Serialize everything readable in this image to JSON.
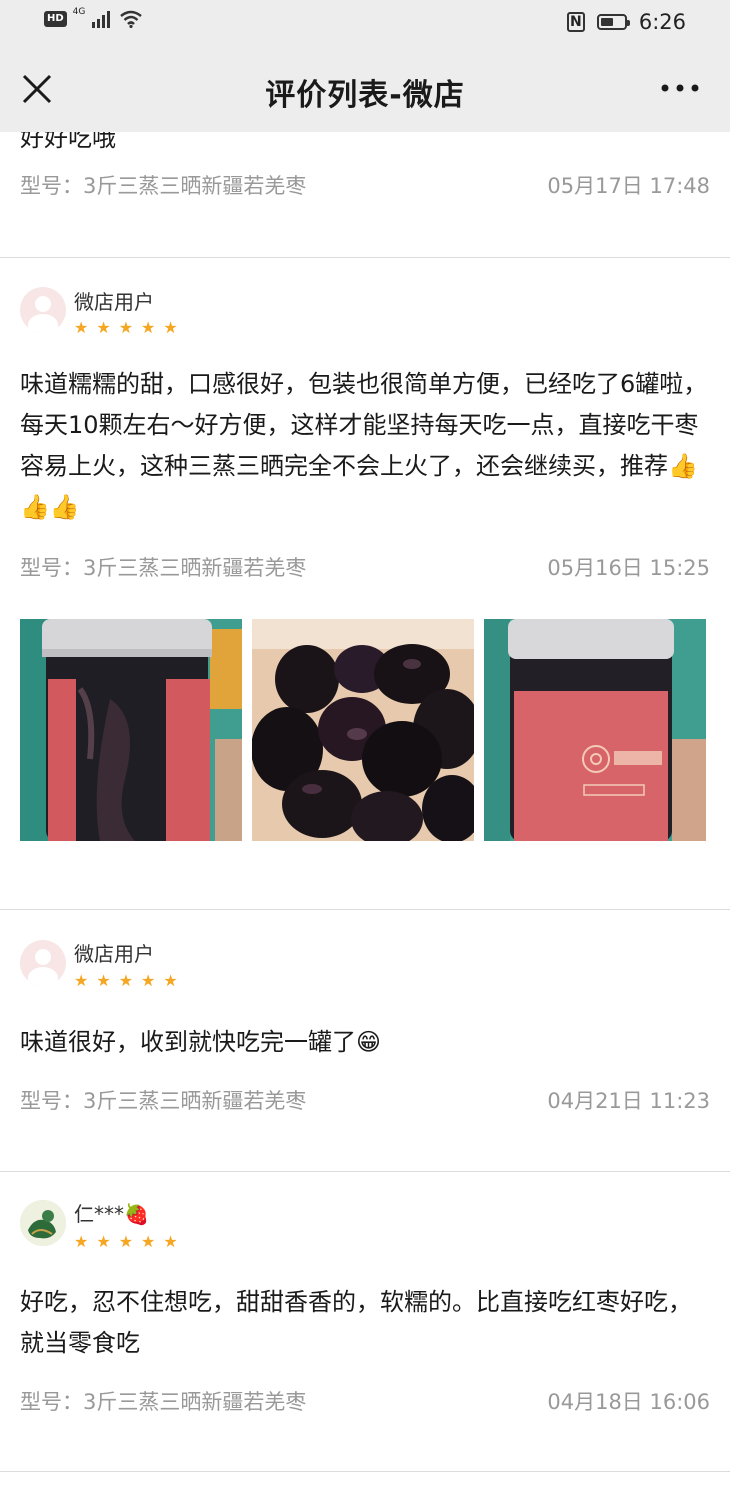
{
  "status_bar": {
    "hd": "HD",
    "network": "4G",
    "time": "6:26",
    "battery_level": 0.55
  },
  "nav": {
    "title": "评价列表-微店"
  },
  "reviews": [
    {
      "partial_text": "好好吃哦",
      "model": "型号：3斤三蒸三晒新疆若羌枣",
      "date": "05月17日 17:48"
    },
    {
      "user": "微店用户",
      "rating": 5,
      "stars": "★★★★★",
      "text": "味道糯糯的甜，口感很好，包装也很简单方便，已经吃了6罐啦，每天10颗左右～好方便，这样才能坚持每天吃一点，直接吃干枣容易上火，这种三蒸三晒完全不会上火了，还会继续买，推荐👍👍👍",
      "model": "型号：3斤三蒸三晒新疆若羌枣",
      "date": "05月16日 15:25",
      "images": [
        "jar-photo",
        "dates-photo",
        "jar-label-photo"
      ]
    },
    {
      "user": "微店用户",
      "rating": 5,
      "stars": "★★★★★",
      "text": "味道很好，收到就快吃完一罐了😁",
      "model": "型号：3斤三蒸三晒新疆若羌枣",
      "date": "04月21日 11:23"
    },
    {
      "user": "仁***🍓",
      "rating": 5,
      "stars": "★★★★★",
      "text": "好吃，忍不住想吃，甜甜香香的，软糯的。比直接吃红枣好吃，就当零食吃",
      "model": "型号：3斤三蒸三晒新疆若羌枣",
      "date": "04月18日 16:06"
    }
  ],
  "colors": {
    "star": "#f5a623",
    "meta_text": "#999999",
    "bar_background": "#ededed"
  }
}
